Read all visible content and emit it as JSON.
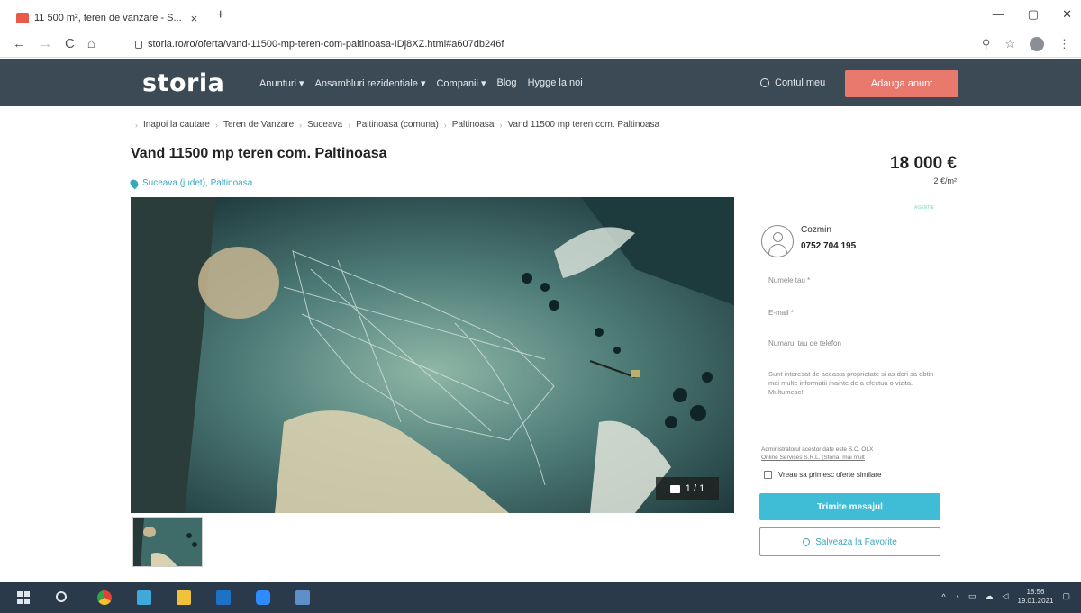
{
  "browser": {
    "tab_title": "11 500 m², teren de vanzare - S...",
    "tab_close": "×",
    "new_tab": "+",
    "url": "storia.ro/ro/oferta/vand-11500-mp-teren-com-paltinoasa-IDj8XZ.html#a607db246f",
    "window_controls": [
      "—",
      "▢",
      "✕"
    ]
  },
  "site": {
    "logo": "storia",
    "menu": [
      "Anunturi ▾",
      "Ansambluri rezidentiale ▾",
      "Companii ▾",
      "Blog",
      "Hygge la noi"
    ],
    "account_label": "Contul meu",
    "add_listing_label": "Adauga anunt"
  },
  "breadcrumb": [
    "Inapoi la cautare",
    "Teren de Vanzare",
    "Suceava",
    "Paltinoasa (comuna)",
    "Paltinoasa",
    "Vand 11500 mp teren com. Paltinoasa"
  ],
  "listing": {
    "title": "Vand 11500 mp teren com. Paltinoasa",
    "location": "Suceava (judet), Paltinoasa",
    "price": "18 000 €",
    "unit_price": "2 €/m²",
    "photo_counter": "1 / 1"
  },
  "contact": {
    "agent_tag": "AGENTIE",
    "seller_name": "Cozmin",
    "seller_phone": "0752 704 195",
    "name_placeholder": "Numele tau *",
    "email_placeholder": "E-mail *",
    "phone_placeholder": "Numarul tau de telefon",
    "message_text": "Sunt interesat de aceasta proprietate si as dori sa obtin mai multe informatii inainte de a efectua o vizita. Multumesc!",
    "admin_note_prefix": "Administratorul acestor date este S.C. OLX",
    "admin_note_link": "Online Services S.R.L. (Storia) mai mult",
    "checkbox_label": "Vreau sa primesc oferte similare",
    "send_label": "Trimite mesajul",
    "favorite_label": "Salveaza la Favorite"
  },
  "taskbar": {
    "time": "18:56",
    "date": "19.01.2021"
  }
}
